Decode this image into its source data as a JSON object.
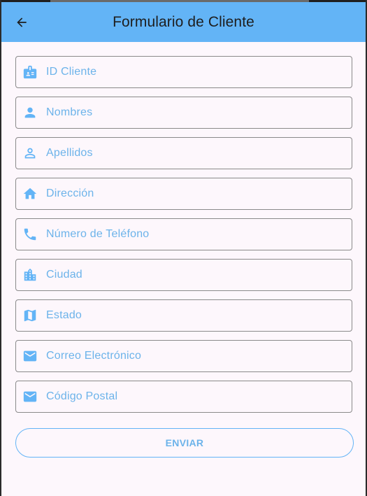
{
  "appbar": {
    "title": "Formulario de Cliente",
    "back_icon": "arrow-back-icon"
  },
  "fields": [
    {
      "label": "ID Cliente",
      "icon": "badge-icon"
    },
    {
      "label": "Nombres",
      "icon": "person-icon"
    },
    {
      "label": "Apellidos",
      "icon": "person-outline-icon"
    },
    {
      "label": "Dirección",
      "icon": "home-icon"
    },
    {
      "label": "Número de Teléfono",
      "icon": "phone-icon"
    },
    {
      "label": "Ciudad",
      "icon": "city-icon"
    },
    {
      "label": "Estado",
      "icon": "map-icon"
    },
    {
      "label": "Correo Electrónico",
      "icon": "email-icon"
    },
    {
      "label": "Código Postal",
      "icon": "email-icon"
    }
  ],
  "submit": {
    "label": "ENVIAR"
  },
  "colors": {
    "appbar": "#63b4f6",
    "accent": "#6cb3ea",
    "background": "#fdf7fc",
    "border": "#8a8a8a"
  }
}
